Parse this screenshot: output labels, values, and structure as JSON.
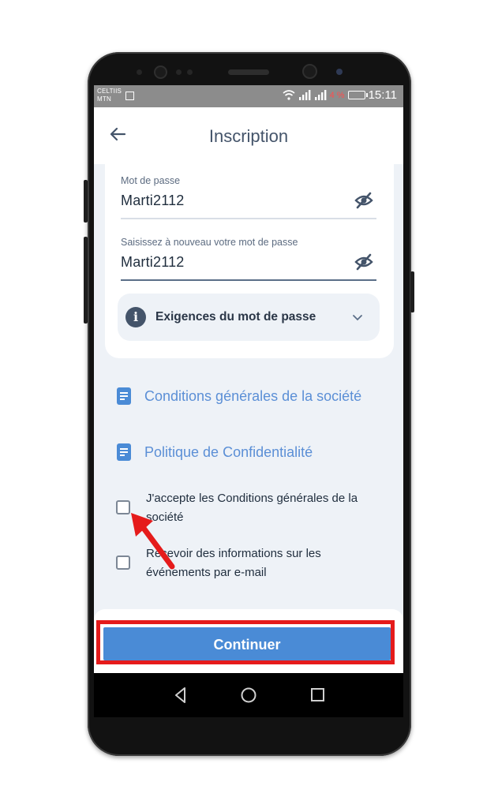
{
  "status_bar": {
    "carrier_line1": "CELTIIS",
    "carrier_line2": "MTN",
    "battery_percent": "4 %",
    "time": "15:11"
  },
  "header": {
    "title": "Inscription"
  },
  "password_form": {
    "password_label": "Mot de passe",
    "password_value": "Marti2112",
    "confirm_label": "Saisissez à nouveau votre mot de passe",
    "confirm_value": "Marti2112",
    "requirements_label": "Exigences du mot de passe"
  },
  "links": [
    {
      "label": "Conditions générales de la société"
    },
    {
      "label": "Politique de Confidentialité"
    }
  ],
  "checkboxes": [
    {
      "label": "J'accepte les Conditions générales de la société",
      "checked": false
    },
    {
      "label": "Recevoir des informations sur les événements par e-mail",
      "checked": false
    }
  ],
  "actions": {
    "continue_label": "Continuer"
  },
  "colors": {
    "accent": "#4a8bd6",
    "annotation": "#e51b1b",
    "link": "#5b8fd6"
  }
}
